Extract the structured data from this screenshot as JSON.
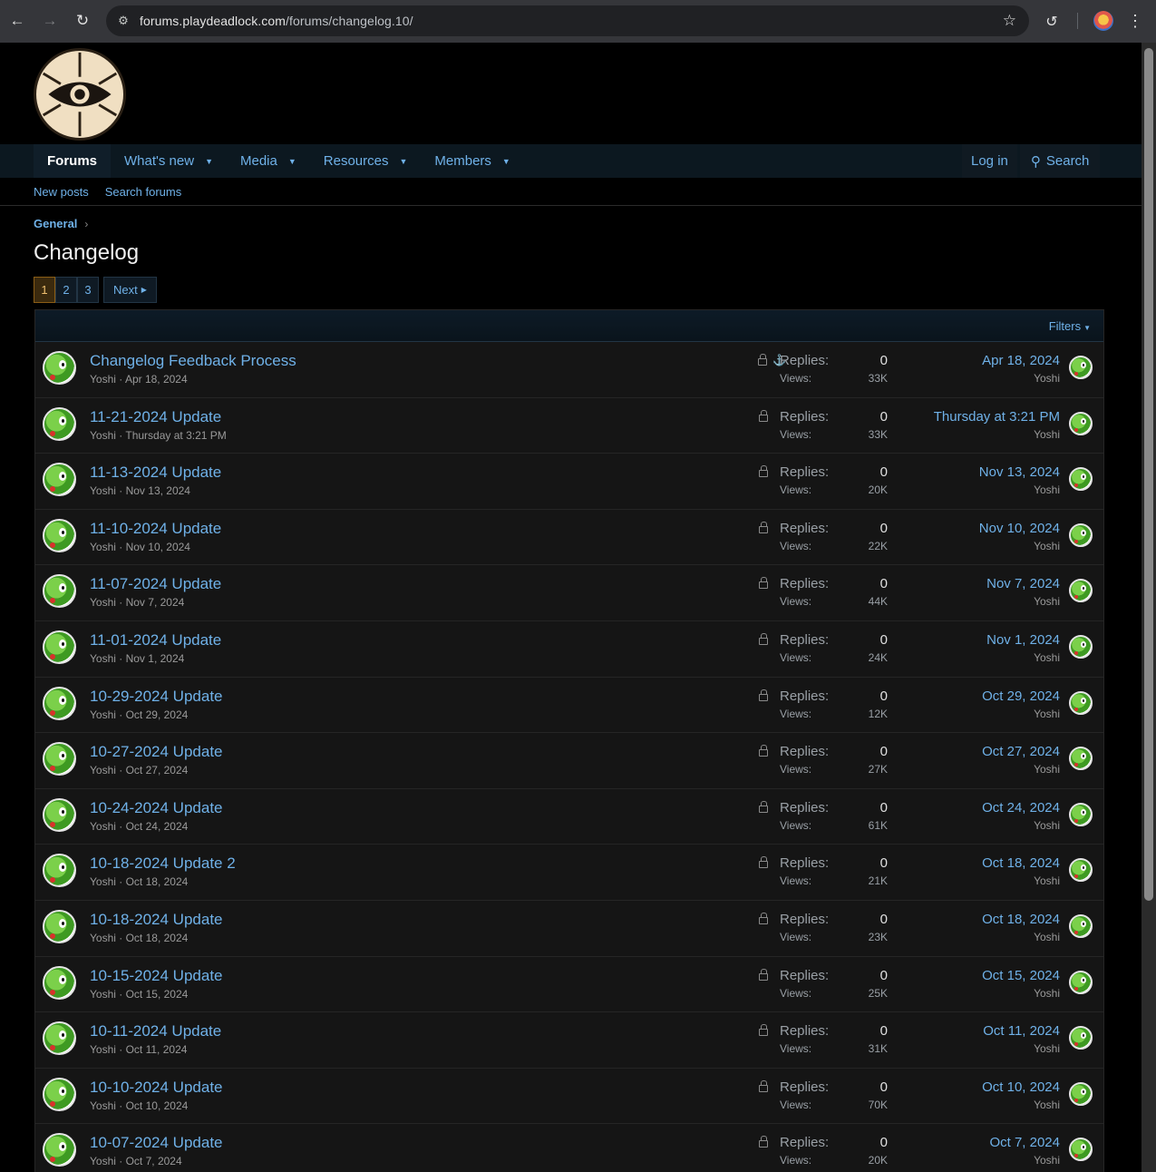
{
  "browser": {
    "url_host": "forums.playdeadlock.com",
    "url_path": "/forums/changelog.10/"
  },
  "nav": {
    "tabs": [
      {
        "label": "Forums",
        "active": true,
        "caret": false
      },
      {
        "label": "What's new",
        "caret": true
      },
      {
        "label": "Media",
        "caret": true
      },
      {
        "label": "Resources",
        "caret": true
      },
      {
        "label": "Members",
        "caret": true
      }
    ],
    "login": "Log in",
    "search": "Search"
  },
  "subnav": {
    "new_posts": "New posts",
    "search_forums": "Search forums"
  },
  "breadcrumb": "General",
  "page_title": "Changelog",
  "pager": {
    "pages": [
      "1",
      "2",
      "3"
    ],
    "current": "1",
    "next": "Next"
  },
  "filters": "Filters",
  "labels": {
    "replies": "Replies:",
    "views": "Views:"
  },
  "threads": [
    {
      "title": "Changelog Feedback Process",
      "author": "Yoshi",
      "date": "Apr 18, 2024",
      "replies": "0",
      "views": "33K",
      "last_date": "Apr 18, 2024",
      "last_user": "Yoshi",
      "sticky": true
    },
    {
      "title": "11-21-2024 Update",
      "author": "Yoshi",
      "date": "Thursday at 3:21 PM",
      "replies": "0",
      "views": "33K",
      "last_date": "Thursday at 3:21 PM",
      "last_user": "Yoshi"
    },
    {
      "title": "11-13-2024 Update",
      "author": "Yoshi",
      "date": "Nov 13, 2024",
      "replies": "0",
      "views": "20K",
      "last_date": "Nov 13, 2024",
      "last_user": "Yoshi"
    },
    {
      "title": "11-10-2024 Update",
      "author": "Yoshi",
      "date": "Nov 10, 2024",
      "replies": "0",
      "views": "22K",
      "last_date": "Nov 10, 2024",
      "last_user": "Yoshi"
    },
    {
      "title": "11-07-2024 Update",
      "author": "Yoshi",
      "date": "Nov 7, 2024",
      "replies": "0",
      "views": "44K",
      "last_date": "Nov 7, 2024",
      "last_user": "Yoshi"
    },
    {
      "title": "11-01-2024 Update",
      "author": "Yoshi",
      "date": "Nov 1, 2024",
      "replies": "0",
      "views": "24K",
      "last_date": "Nov 1, 2024",
      "last_user": "Yoshi"
    },
    {
      "title": "10-29-2024 Update",
      "author": "Yoshi",
      "date": "Oct 29, 2024",
      "replies": "0",
      "views": "12K",
      "last_date": "Oct 29, 2024",
      "last_user": "Yoshi"
    },
    {
      "title": "10-27-2024 Update",
      "author": "Yoshi",
      "date": "Oct 27, 2024",
      "replies": "0",
      "views": "27K",
      "last_date": "Oct 27, 2024",
      "last_user": "Yoshi"
    },
    {
      "title": "10-24-2024 Update",
      "author": "Yoshi",
      "date": "Oct 24, 2024",
      "replies": "0",
      "views": "61K",
      "last_date": "Oct 24, 2024",
      "last_user": "Yoshi"
    },
    {
      "title": "10-18-2024 Update 2",
      "author": "Yoshi",
      "date": "Oct 18, 2024",
      "replies": "0",
      "views": "21K",
      "last_date": "Oct 18, 2024",
      "last_user": "Yoshi"
    },
    {
      "title": "10-18-2024 Update",
      "author": "Yoshi",
      "date": "Oct 18, 2024",
      "replies": "0",
      "views": "23K",
      "last_date": "Oct 18, 2024",
      "last_user": "Yoshi"
    },
    {
      "title": "10-15-2024 Update",
      "author": "Yoshi",
      "date": "Oct 15, 2024",
      "replies": "0",
      "views": "25K",
      "last_date": "Oct 15, 2024",
      "last_user": "Yoshi"
    },
    {
      "title": "10-11-2024 Update",
      "author": "Yoshi",
      "date": "Oct 11, 2024",
      "replies": "0",
      "views": "31K",
      "last_date": "Oct 11, 2024",
      "last_user": "Yoshi"
    },
    {
      "title": "10-10-2024 Update",
      "author": "Yoshi",
      "date": "Oct 10, 2024",
      "replies": "0",
      "views": "70K",
      "last_date": "Oct 10, 2024",
      "last_user": "Yoshi"
    },
    {
      "title": "10-07-2024 Update",
      "author": "Yoshi",
      "date": "Oct 7, 2024",
      "replies": "0",
      "views": "20K",
      "last_date": "Oct 7, 2024",
      "last_user": "Yoshi"
    }
  ]
}
